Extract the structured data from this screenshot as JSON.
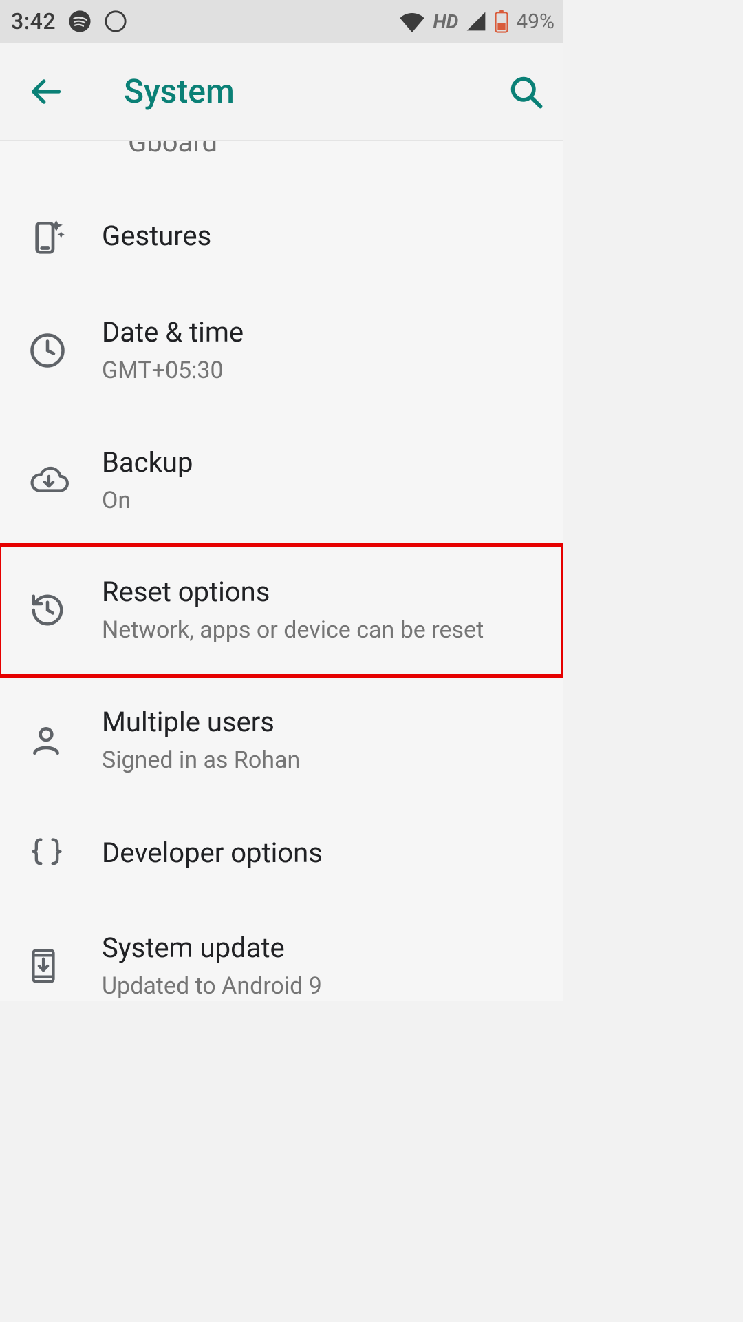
{
  "status": {
    "time": "3:42",
    "hd": "HD",
    "battery": "49%"
  },
  "appbar": {
    "title": "System"
  },
  "cutoff_text": "Gboard",
  "items": [
    {
      "title": "Gestures",
      "subtitle": ""
    },
    {
      "title": "Date & time",
      "subtitle": "GMT+05:30"
    },
    {
      "title": "Backup",
      "subtitle": "On"
    },
    {
      "title": "Reset options",
      "subtitle": "Network, apps or device can be reset"
    },
    {
      "title": "Multiple users",
      "subtitle": "Signed in as Rohan"
    },
    {
      "title": "Developer options",
      "subtitle": ""
    },
    {
      "title": "System update",
      "subtitle": "Updated to Android 9"
    }
  ]
}
